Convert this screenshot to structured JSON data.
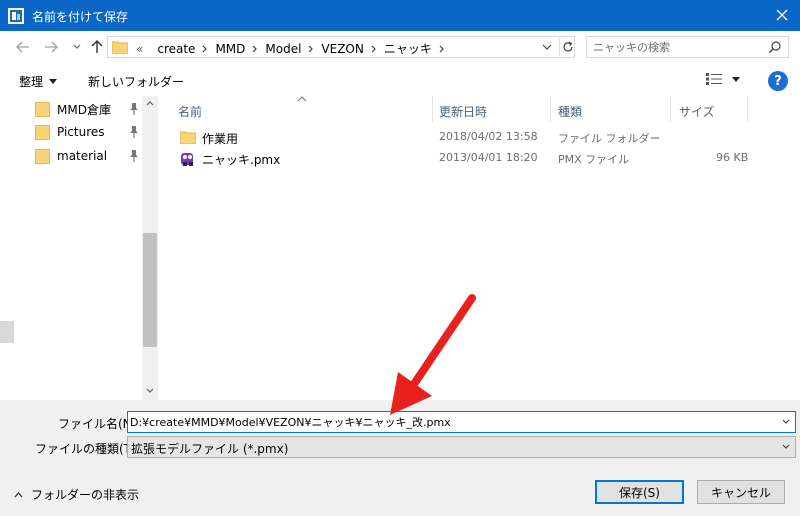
{
  "window": {
    "title": "名前を付けて保存",
    "accent": "#0b67c5"
  },
  "address_bar": {
    "prefix": "«",
    "crumbs": [
      "create",
      "MMD",
      "Model",
      "VEZON",
      "ニャッキ"
    ]
  },
  "search": {
    "placeholder": "ニャッキの検索"
  },
  "toolbar": {
    "organize_label": "整理",
    "new_folder_label": "新しいフォルダー",
    "help_label": "?"
  },
  "sidebar": {
    "items": [
      {
        "label": "MMD倉庫",
        "pinned": true
      },
      {
        "label": "Pictures",
        "pinned": true
      },
      {
        "label": "material",
        "pinned": true
      }
    ]
  },
  "file_list": {
    "columns": [
      "名前",
      "更新日時",
      "種類",
      "サイズ"
    ],
    "rows": [
      {
        "name": "作業用",
        "date": "2018/04/02 13:58",
        "type": "ファイル フォルダー",
        "size": "",
        "icon": "folder-icon"
      },
      {
        "name": "ニャッキ.pmx",
        "date": "2013/04/01 18:20",
        "type": "PMX ファイル",
        "size": "96 KB",
        "icon": "pmx-file-icon"
      }
    ]
  },
  "form": {
    "filename_label": "ファイル名(N):",
    "filename_value": "D:¥create¥MMD¥Model¥VEZON¥ニャッキ¥ニャッキ_改.pmx",
    "filetype_label": "ファイルの種類(T):",
    "filetype_value": "拡張モデルファイル (*.pmx)"
  },
  "footer": {
    "hide_folders_label": "フォルダーの非表示",
    "save_label": "保存(S)",
    "cancel_label": "キャンセル"
  },
  "annotation": {
    "arrow_color": "#e8211e"
  }
}
